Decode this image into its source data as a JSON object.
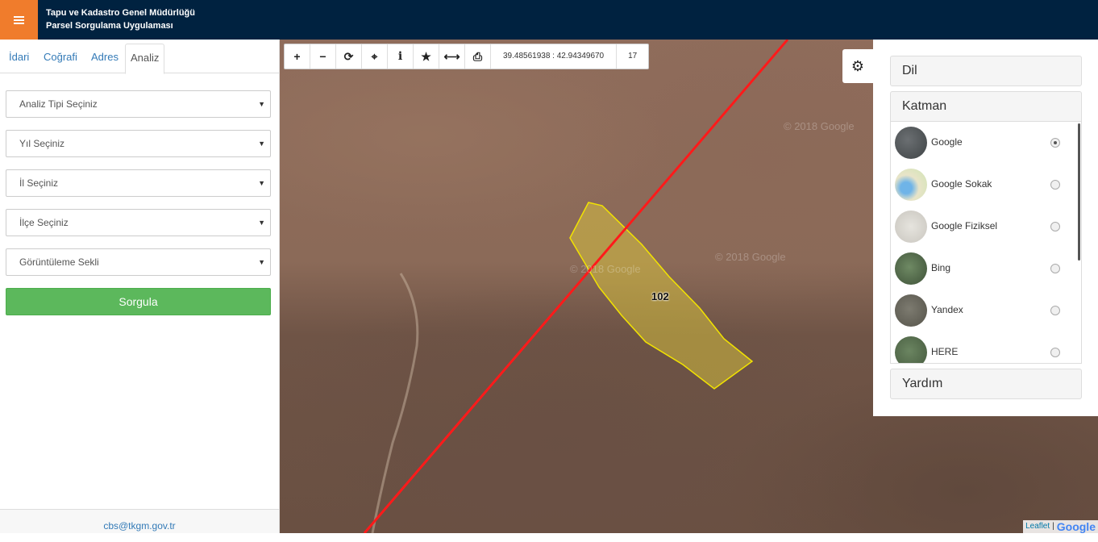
{
  "header": {
    "title_line1": "Tapu ve Kadastro Genel Müdürlüğü",
    "title_line2": "Parsel Sorgulama Uygulaması",
    "accent_color": "#f07c2c",
    "bar_color": "#002240"
  },
  "sidebar": {
    "tabs": [
      {
        "label": "İdari"
      },
      {
        "label": "Coğrafi"
      },
      {
        "label": "Adres"
      },
      {
        "label": "Analiz",
        "active": true
      }
    ],
    "selects": [
      {
        "value": "Analiz Tipi Seçiniz"
      },
      {
        "value": "Yıl Seçiniz"
      },
      {
        "value": "İl Seçiniz"
      },
      {
        "value": "İlçe Seçiniz"
      },
      {
        "value": "Görüntüleme Sekli"
      }
    ],
    "query_button": "Sorgula",
    "footer_email": "cbs@tkgm.gov.tr"
  },
  "map": {
    "coordinates": "39.48561938 : 42.94349670",
    "zoom": "17",
    "parcel_label": "102",
    "watermark1": "© 2018 Google",
    "watermark2": "© 2018 Google",
    "watermark3": "© 2018 Google",
    "toolbar_icons": [
      "zoom-in-icon",
      "zoom-out-icon",
      "refresh-icon",
      "locate-icon",
      "info-icon",
      "star-icon",
      "measure-icon",
      "print-icon"
    ],
    "attribution_leaflet": "Leaflet",
    "attribution_sep": "|",
    "attribution_google": "Google"
  },
  "panel": {
    "accordion": {
      "language": "Dil",
      "layers": "Katman",
      "help": "Yardım"
    },
    "layers": [
      {
        "name": "Google",
        "checked": true
      },
      {
        "name": "Google Sokak",
        "checked": false
      },
      {
        "name": "Google Fiziksel",
        "checked": false
      },
      {
        "name": "Bing",
        "checked": false
      },
      {
        "name": "Yandex",
        "checked": false
      },
      {
        "name": "HERE",
        "checked": false
      }
    ]
  }
}
